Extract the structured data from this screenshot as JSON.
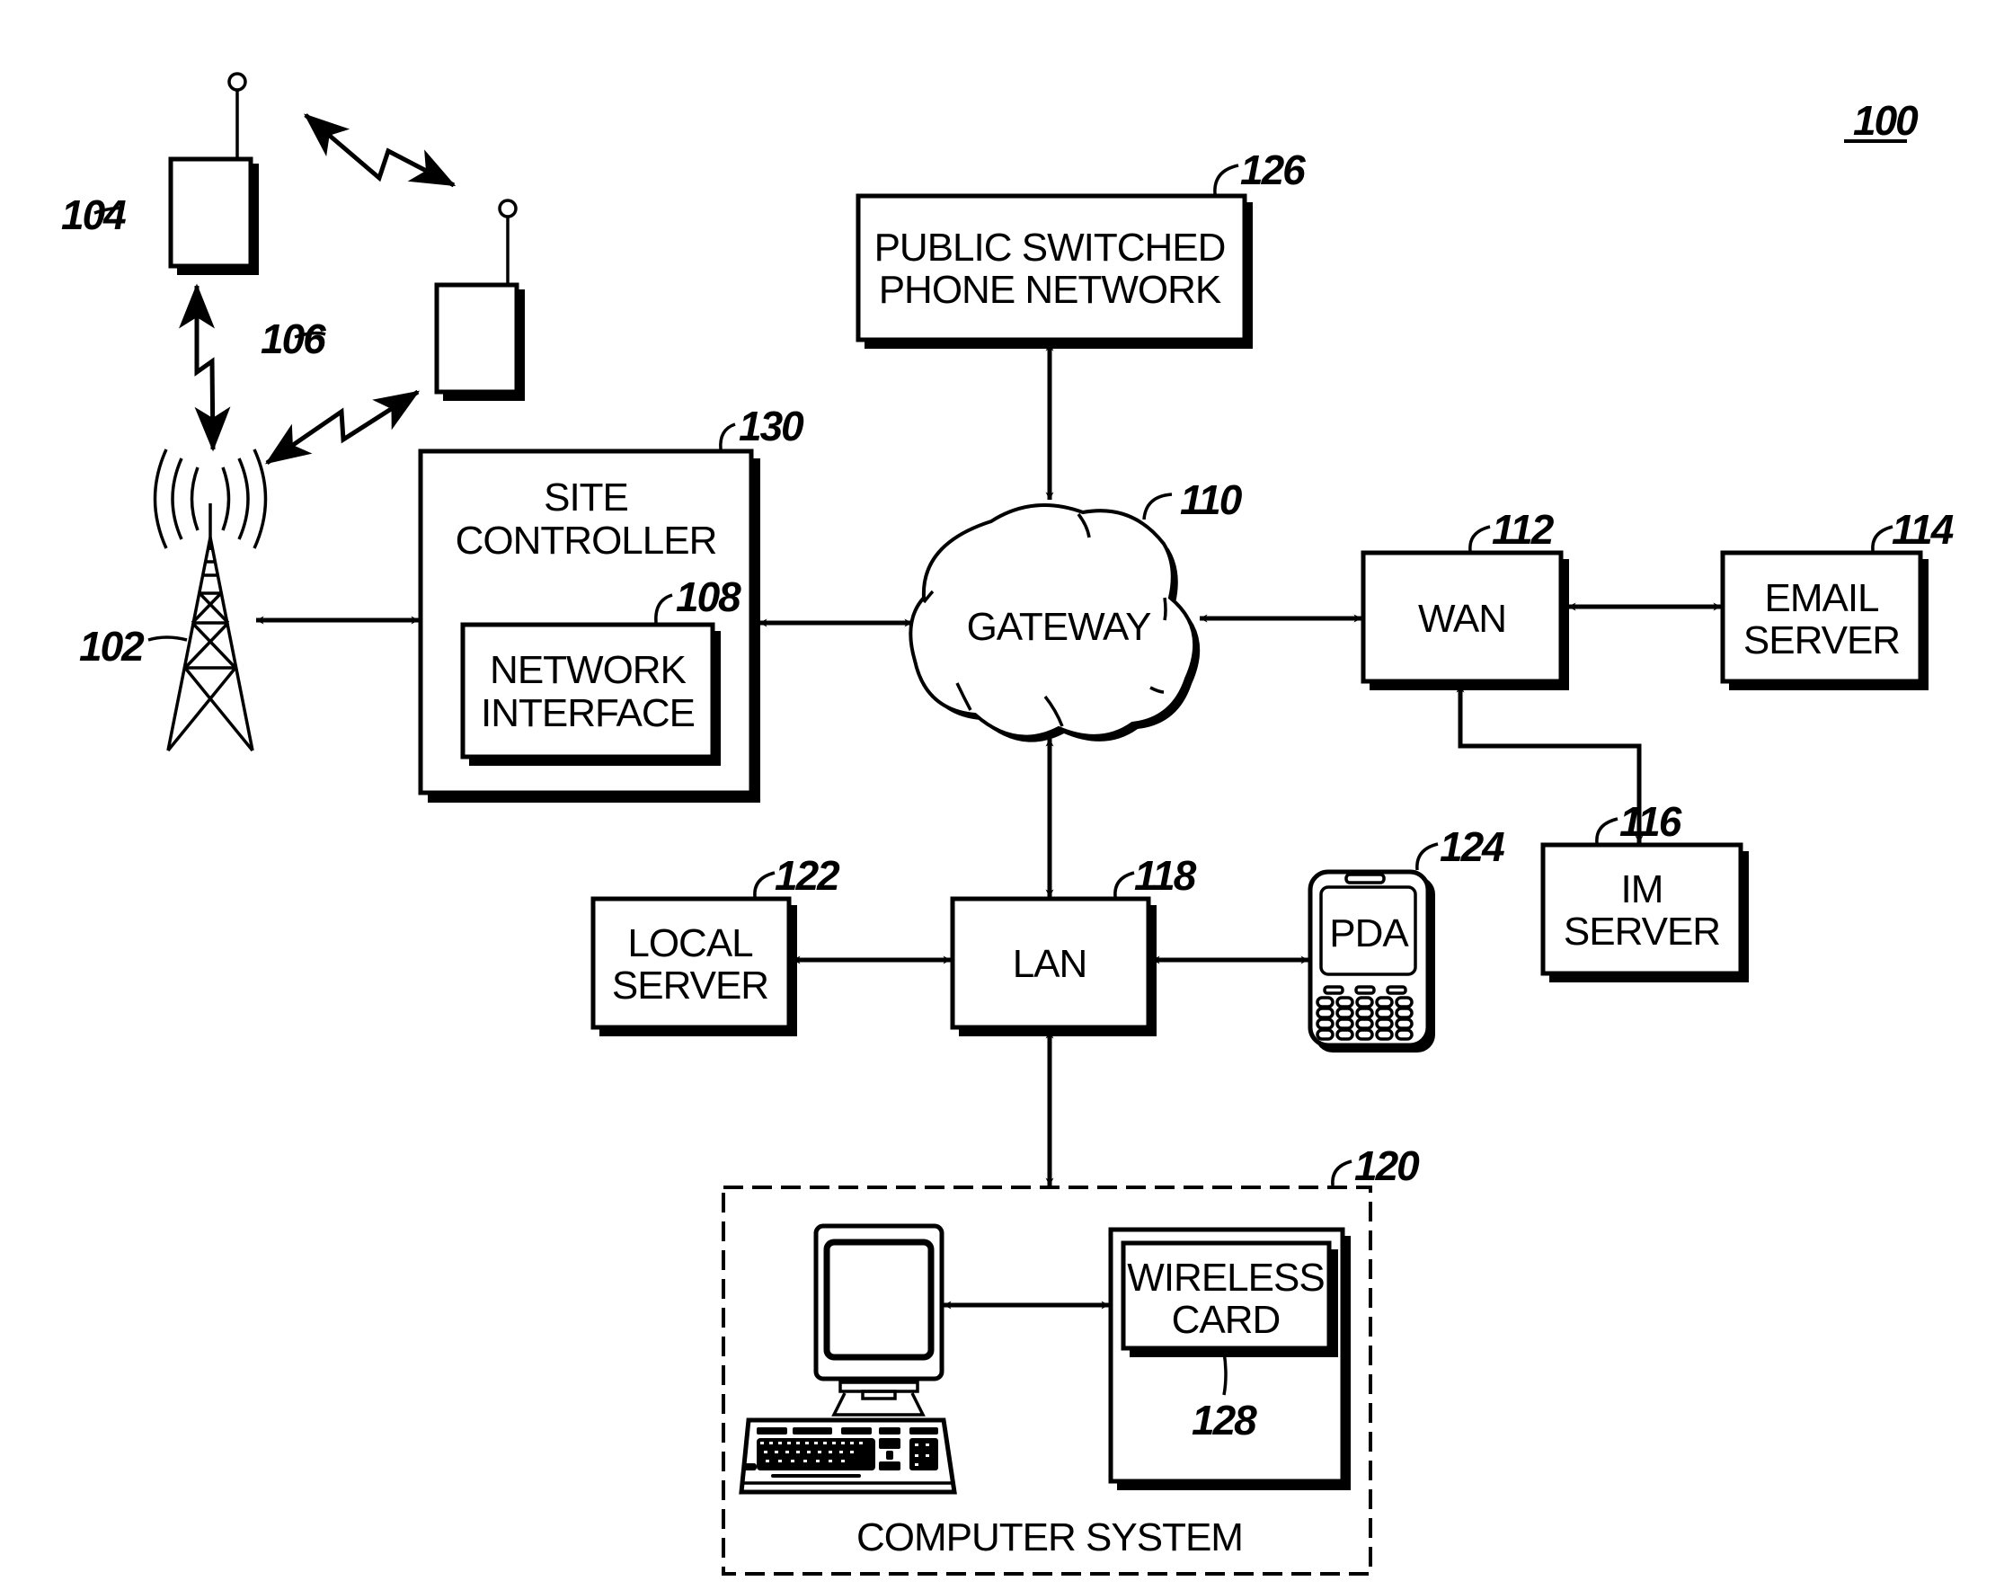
{
  "figure": {
    "figure_ref": "100",
    "accent_color": "#000000",
    "background_color": "#ffffff"
  },
  "nodes": {
    "subscriber_unit_1": {
      "ref": "104",
      "label": ""
    },
    "subscriber_unit_2": {
      "ref": "106",
      "label": ""
    },
    "base_station_tower": {
      "ref": "102",
      "label": ""
    },
    "site_controller": {
      "ref": "130",
      "label_lines": [
        "SITE",
        "CONTROLLER"
      ]
    },
    "network_interface": {
      "ref": "108",
      "label_lines": [
        "NETWORK",
        "INTERFACE"
      ]
    },
    "pstn": {
      "ref": "126",
      "label_lines": [
        "PUBLIC SWITCHED",
        "PHONE NETWORK"
      ]
    },
    "gateway": {
      "ref": "110",
      "label_lines": [
        "GATEWAY"
      ]
    },
    "wan": {
      "ref": "112",
      "label_lines": [
        "WAN"
      ]
    },
    "email_server": {
      "ref": "114",
      "label_lines": [
        "EMAIL",
        "SERVER"
      ]
    },
    "im_server": {
      "ref": "116",
      "label_lines": [
        "IM",
        "SERVER"
      ]
    },
    "lan": {
      "ref": "118",
      "label_lines": [
        "LAN"
      ]
    },
    "local_server": {
      "ref": "122",
      "label_lines": [
        "LOCAL",
        "SERVER"
      ]
    },
    "pda": {
      "ref": "124",
      "label_lines": [
        "PDA"
      ]
    },
    "computer_system": {
      "ref": "120",
      "label_lines": [
        "COMPUTER SYSTEM"
      ]
    },
    "wireless_card": {
      "ref": "128",
      "label_lines": [
        "WIRELESS",
        "CARD"
      ]
    }
  },
  "connections": [
    {
      "from": "subscriber_unit_1",
      "to": "subscriber_unit_2",
      "type": "wireless",
      "bidirectional": true
    },
    {
      "from": "subscriber_unit_1",
      "to": "base_station_tower",
      "type": "wireless",
      "bidirectional": true
    },
    {
      "from": "subscriber_unit_2",
      "to": "base_station_tower",
      "type": "wireless",
      "bidirectional": true
    },
    {
      "from": "base_station_tower",
      "to": "site_controller",
      "type": "wired",
      "bidirectional": true
    },
    {
      "from": "site_controller",
      "to": "gateway",
      "type": "wired",
      "bidirectional": true
    },
    {
      "from": "pstn",
      "to": "gateway",
      "type": "wired",
      "bidirectional": true
    },
    {
      "from": "gateway",
      "to": "wan",
      "type": "wired",
      "bidirectional": true
    },
    {
      "from": "wan",
      "to": "email_server",
      "type": "wired",
      "bidirectional": true
    },
    {
      "from": "wan",
      "to": "im_server",
      "type": "wired",
      "bidirectional": true
    },
    {
      "from": "gateway",
      "to": "lan",
      "type": "wired",
      "bidirectional": true
    },
    {
      "from": "local_server",
      "to": "lan",
      "type": "wired",
      "bidirectional": true
    },
    {
      "from": "lan",
      "to": "pda",
      "type": "wired",
      "bidirectional": true
    },
    {
      "from": "lan",
      "to": "computer_system",
      "type": "wired",
      "bidirectional": true
    },
    {
      "from": "computer_monitor",
      "to": "wireless_card",
      "type": "wired",
      "bidirectional": true
    }
  ]
}
